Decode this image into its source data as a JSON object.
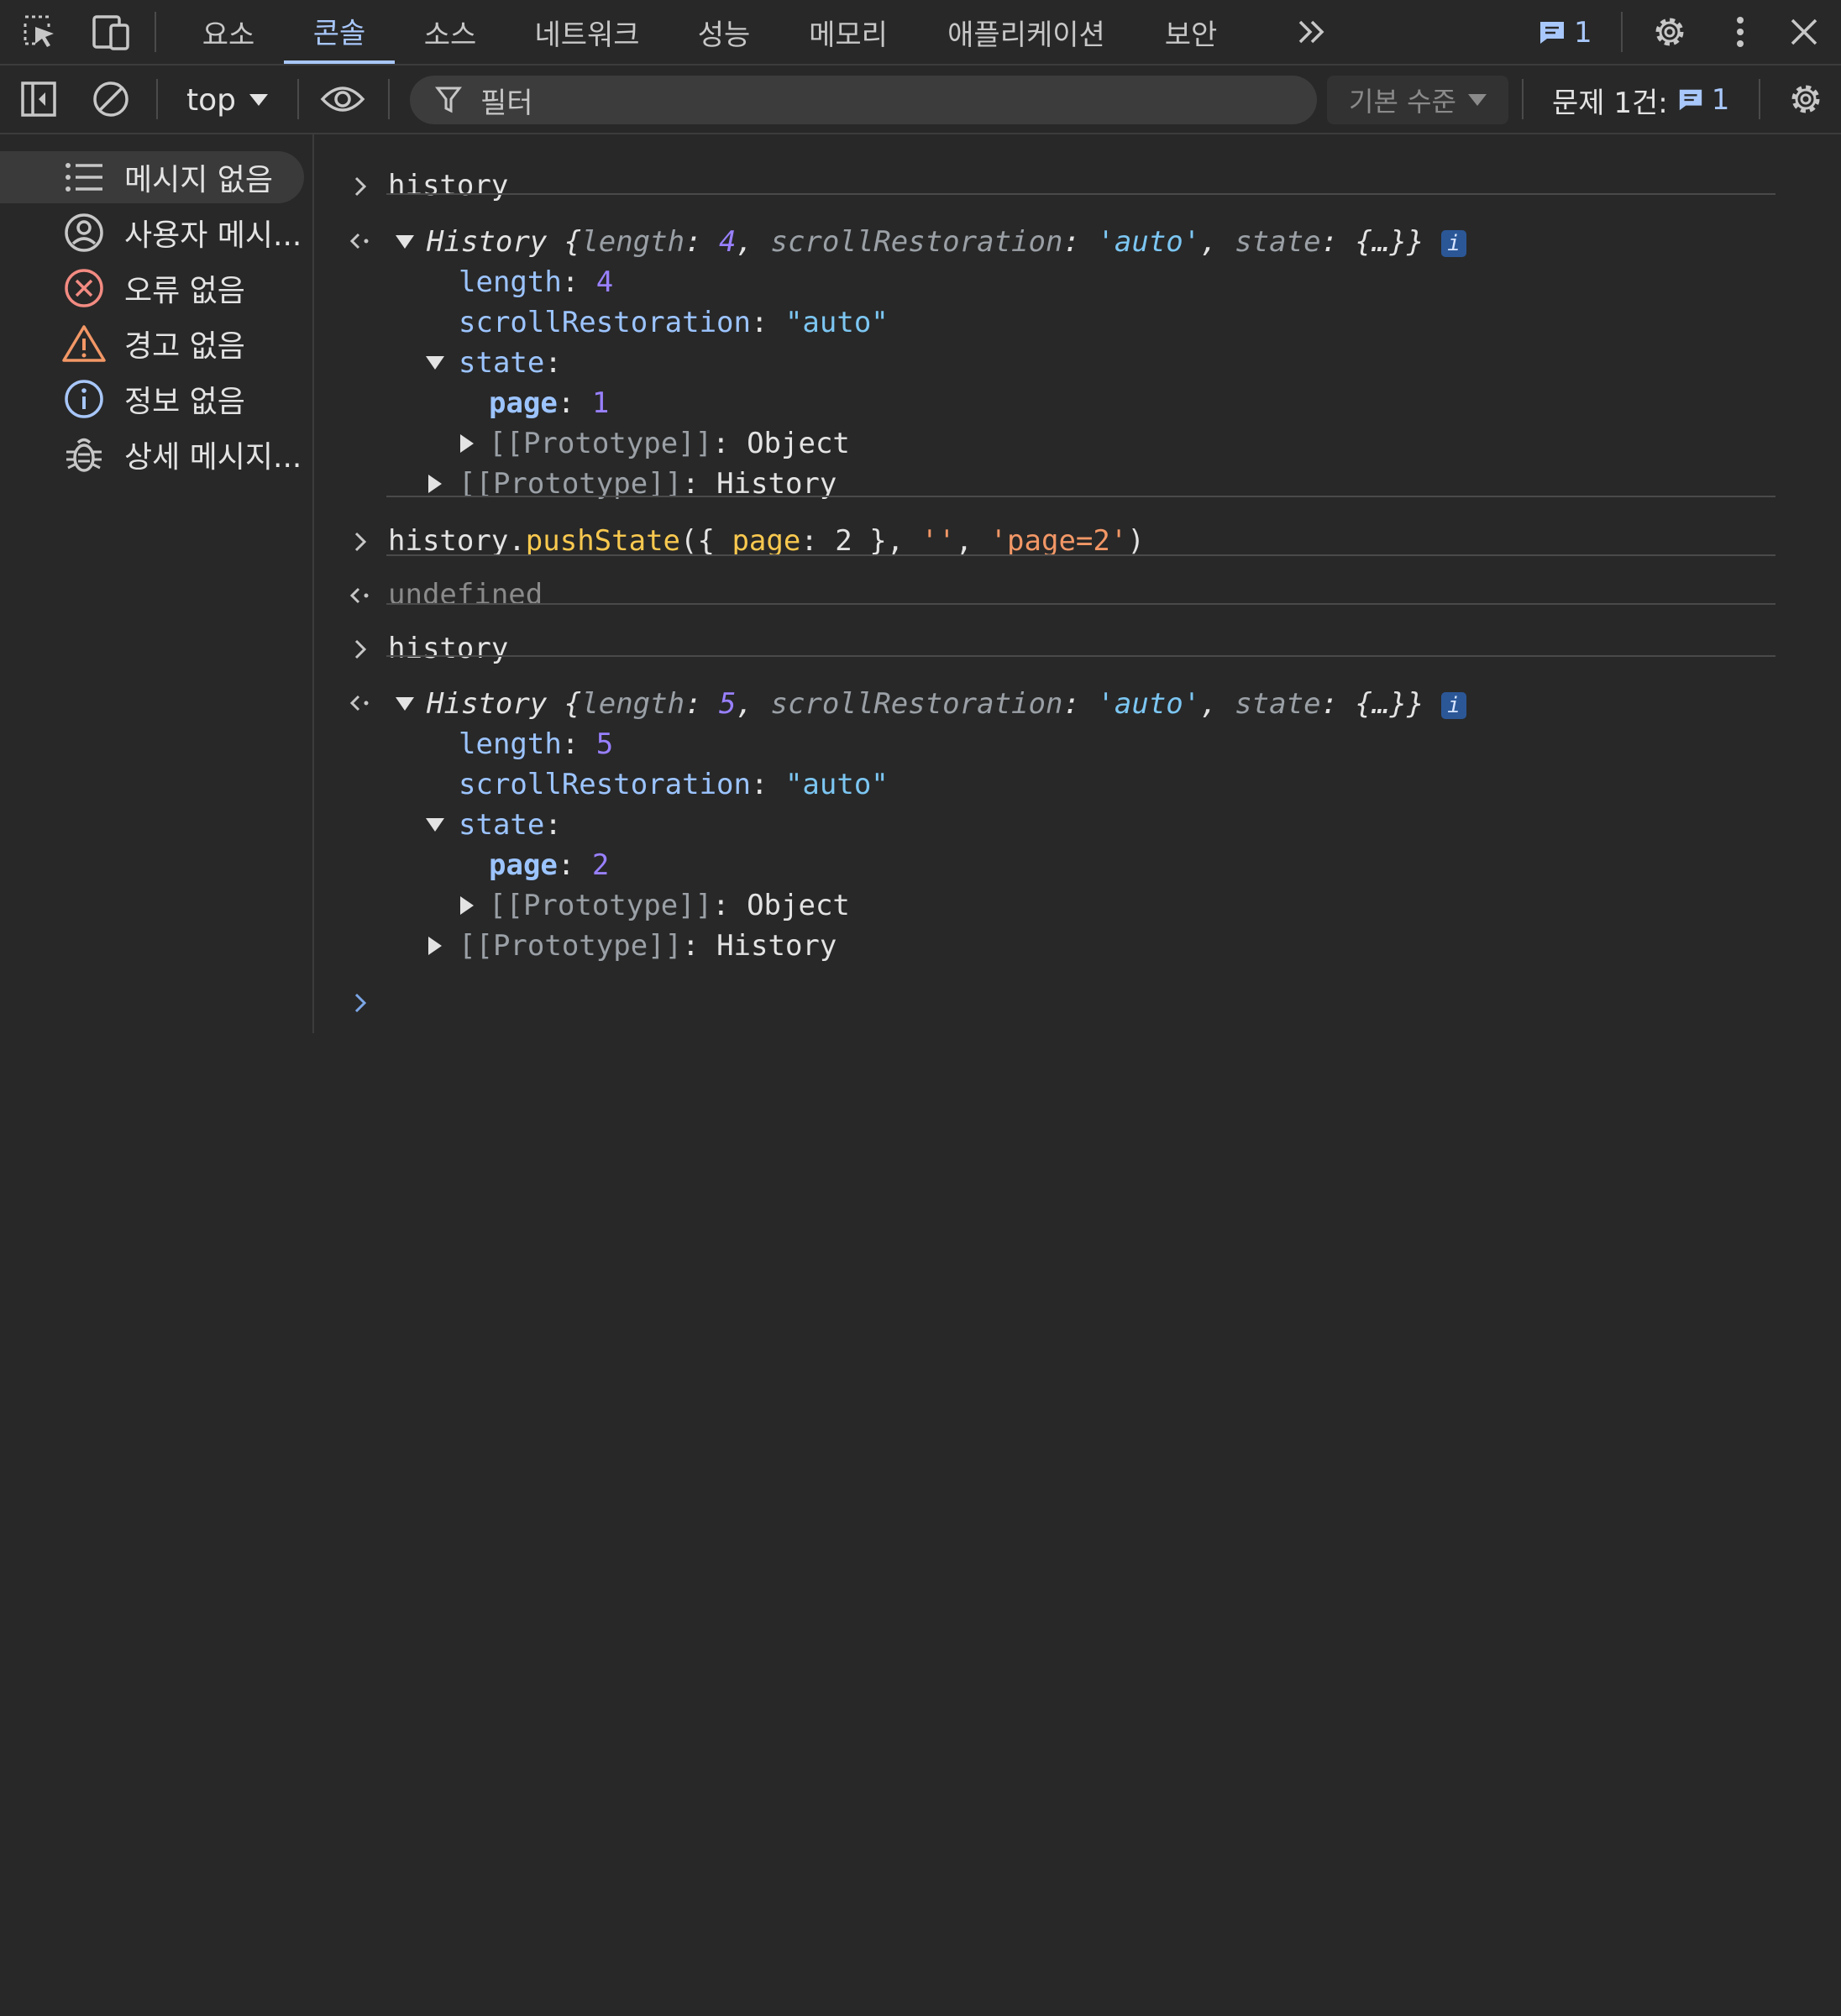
{
  "colors": {
    "background": "#282828",
    "accent": "#a8c7fa",
    "string": "#7cc6f2",
    "number": "#9980ff",
    "key": "#9cc4ff",
    "function": "#f9c94f",
    "single_quoted_string": "#f29766",
    "error_icon": "#f28b82",
    "warning_icon": "#f29766",
    "info_icon": "#a8c7fa"
  },
  "tabs": [
    {
      "label": "요소",
      "active": false
    },
    {
      "label": "콘솔",
      "active": true
    },
    {
      "label": "소스",
      "active": false
    },
    {
      "label": "네트워크",
      "active": false
    },
    {
      "label": "성능",
      "active": false
    },
    {
      "label": "메모리",
      "active": false
    },
    {
      "label": "애플리케이션",
      "active": false
    },
    {
      "label": "보안",
      "active": false
    }
  ],
  "topbar": {
    "message_count": "1",
    "icons": [
      "inspect-element-icon",
      "device-toolbar-icon",
      "more-tabs-icon",
      "message-icon",
      "settings-icon",
      "more-options-icon",
      "close-icon"
    ]
  },
  "toolbar": {
    "context": "top",
    "filter_placeholder": "필터",
    "level": "기본 수준",
    "issues_label": "문제 1건:",
    "issues_count": "1",
    "icons": [
      "sidebar-toggle-icon",
      "clear-console-icon",
      "eye-icon",
      "filter-icon",
      "settings-icon"
    ]
  },
  "sidebar": {
    "items": [
      {
        "label": "메시지 없음",
        "icon": "list-icon",
        "selected": true
      },
      {
        "label": "사용자 메시...",
        "icon": "user-icon",
        "selected": false
      },
      {
        "label": "오류 없음",
        "icon": "error-icon",
        "selected": false
      },
      {
        "label": "경고 없음",
        "icon": "warning-icon",
        "selected": false
      },
      {
        "label": "정보 없음",
        "icon": "info-icon",
        "selected": false
      },
      {
        "label": "상세 메시지...",
        "icon": "bug-icon",
        "selected": false
      }
    ]
  },
  "console": {
    "input1": "history",
    "result1": {
      "class": "History",
      "summary_length": "4",
      "summary_scroll": "'auto'",
      "summary_state": "{…}",
      "length": "4",
      "scroll": "\"auto\"",
      "state_page": "1",
      "proto_object": "Object",
      "proto_history": "History"
    },
    "input2": {
      "obj": "history",
      "method": "pushState",
      "arg_key": "page",
      "arg_val": "2",
      "arg2": "''",
      "arg3": "'page=2'"
    },
    "result2": "undefined",
    "input3": "history",
    "result3": {
      "class": "History",
      "summary_length": "5",
      "summary_scroll": "'auto'",
      "summary_state": "{…}",
      "length": "5",
      "scroll": "\"auto\"",
      "state_page": "2",
      "proto_object": "Object",
      "proto_history": "History"
    },
    "labels": {
      "length": "length",
      "scroll": "scrollRestoration",
      "state": "state",
      "page": "page",
      "prototype": "[[Prototype]]",
      "info_badge": "i"
    }
  }
}
